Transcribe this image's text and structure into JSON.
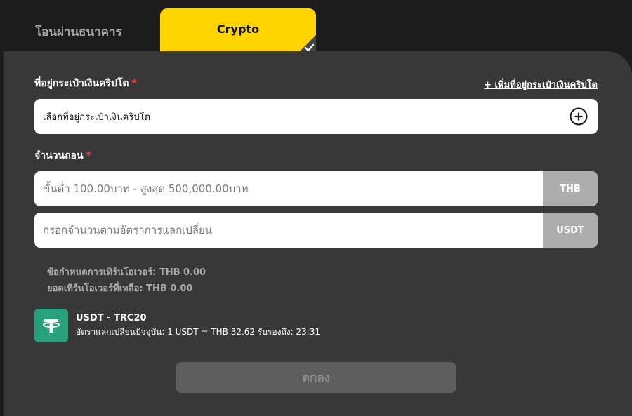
{
  "tabs": {
    "bank_transfer": "โอนผ่านธนาคาร",
    "crypto": "Crypto"
  },
  "wallet": {
    "label": "ที่อยู่กระเป๋าเงินคริปโต",
    "required_mark": "*",
    "add_link": "+ เพิ่มที่อยู่กระเป๋าเงินคริปโต",
    "select_text": "เลือกที่อยู่กระเป๋าเงินคริปโต"
  },
  "amount": {
    "label": "จำนวนถอน",
    "required_mark": "*",
    "thb_placeholder": "ขั้นต่ำ 100.00บาท - สูงสุด 500,000.00บาท",
    "thb_unit": "THB",
    "usdt_placeholder": "กรอกจำนวนตามอัตราการแลกเปลี่ยน",
    "usdt_unit": "USDT"
  },
  "turnover": {
    "requirement": "ข้อกำหนดการเทิร์นโอเวอร์: THB 0.00",
    "remaining": "ยอดเทิร์นโอเวอร์ที่เหลือ: THB 0.00"
  },
  "coin": {
    "title": "USDT - TRC20",
    "rate": "อัตราแลกเปลี่ยนปัจจุบัน: 1 USDT = THB 32.62 รับรองถึง: 23:31"
  },
  "submit_label": "ตกลง",
  "colors": {
    "accent": "#ffd400",
    "panel": "#383838",
    "background": "#1c1c1c",
    "tether": "#26a17b",
    "required": "#ff3b3b"
  }
}
